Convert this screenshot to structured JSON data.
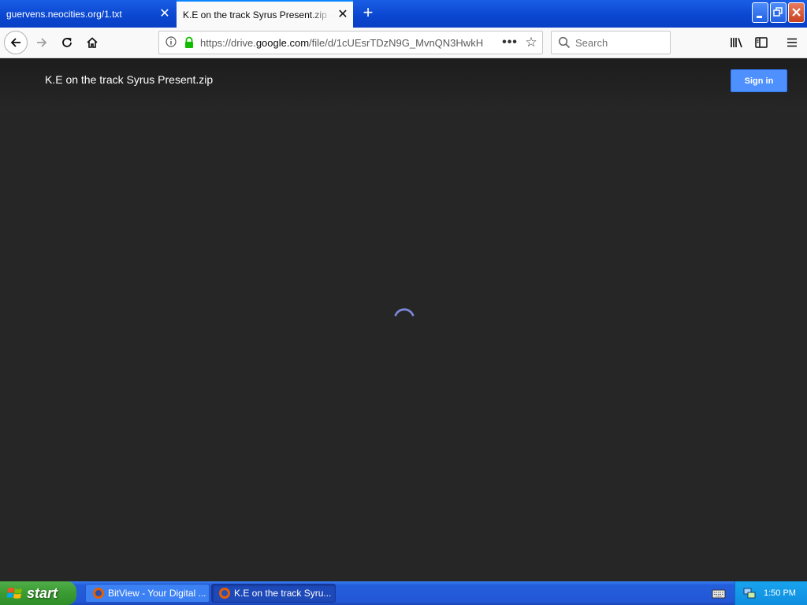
{
  "browser": {
    "tabs": [
      {
        "title": "guervens.neocities.org/1.txt",
        "active": false
      },
      {
        "title": "K.E on the track Syrus Present.zip - Google Drive",
        "active": true
      }
    ],
    "url_prefix": "https://drive.",
    "url_domain": "google.com",
    "url_path": "/file/d/1cUEsrTDzN9G_MvnQN3HwkH",
    "search_placeholder": "Search"
  },
  "page": {
    "file_title": "K.E on the track Syrus Present.zip",
    "signin_label": "Sign in"
  },
  "taskbar": {
    "start_label": "start",
    "tasks": [
      {
        "label": "BitView - Your Digital ...",
        "active": false
      },
      {
        "label": "K.E on the track Syru...",
        "active": true
      }
    ],
    "clock": "1:50 PM"
  },
  "colors": {
    "page_bg": "#262626",
    "signin_blue": "#4d90fe",
    "spinner": "#7b86d6"
  }
}
